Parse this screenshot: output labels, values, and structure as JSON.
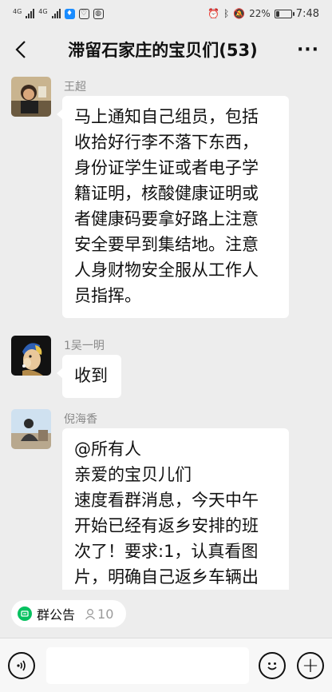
{
  "status_bar": {
    "network_1": "4G",
    "network_2": "4G",
    "battery_percent": "22%",
    "battery_level": 0.22,
    "time": "7:48",
    "icons": [
      "signal-icon",
      "signal-icon",
      "app-notification-icon",
      "heart-icon",
      "wechat-icon",
      "alarm-icon",
      "bluetooth-icon",
      "mute-icon",
      "battery-icon"
    ]
  },
  "header": {
    "back_icon": "chevron-left-icon",
    "title": "滞留石家庄的宝贝们(53)",
    "more_icon": "more-dots-icon",
    "more_label": "···"
  },
  "messages": [
    {
      "sender": "王超",
      "avatar": "avatar-photo-person",
      "lines": [
        "马上通知自己组员，包括",
        "收拾好行李不落下东西，",
        "身份证学生证或者电子学",
        "籍证明，核酸健康证明或",
        "者健康码要拿好路上注意",
        "安全要早到集结地。注意",
        "人身财物安全服从工作人",
        "员指挥。"
      ]
    },
    {
      "sender": "1吴一明",
      "avatar": "avatar-pearl-earring-dog",
      "lines": [
        "收到"
      ]
    },
    {
      "sender": "倪海香",
      "avatar": "avatar-photo-outdoor",
      "lines": [
        "@所有人",
        "亲爱的宝贝儿们",
        "速度看群消息，今天中午",
        "开始已经有返乡安排的班",
        "次了！要求:1，认真看图",
        "片，明确自己返乡车辆出"
      ]
    }
  ],
  "notice": {
    "label": "群公告",
    "count": "10",
    "icon": "announcement-icon",
    "count_icon": "person-icon"
  },
  "input_bar": {
    "voice_icon": "voice-icon",
    "emoji_icon": "emoji-icon",
    "plus_icon": "plus-icon",
    "plus_label": "+"
  },
  "colors": {
    "background": "#ededed",
    "bubble": "#ffffff",
    "accent_green": "#07c160",
    "sender_gray": "#8a8a8a"
  }
}
